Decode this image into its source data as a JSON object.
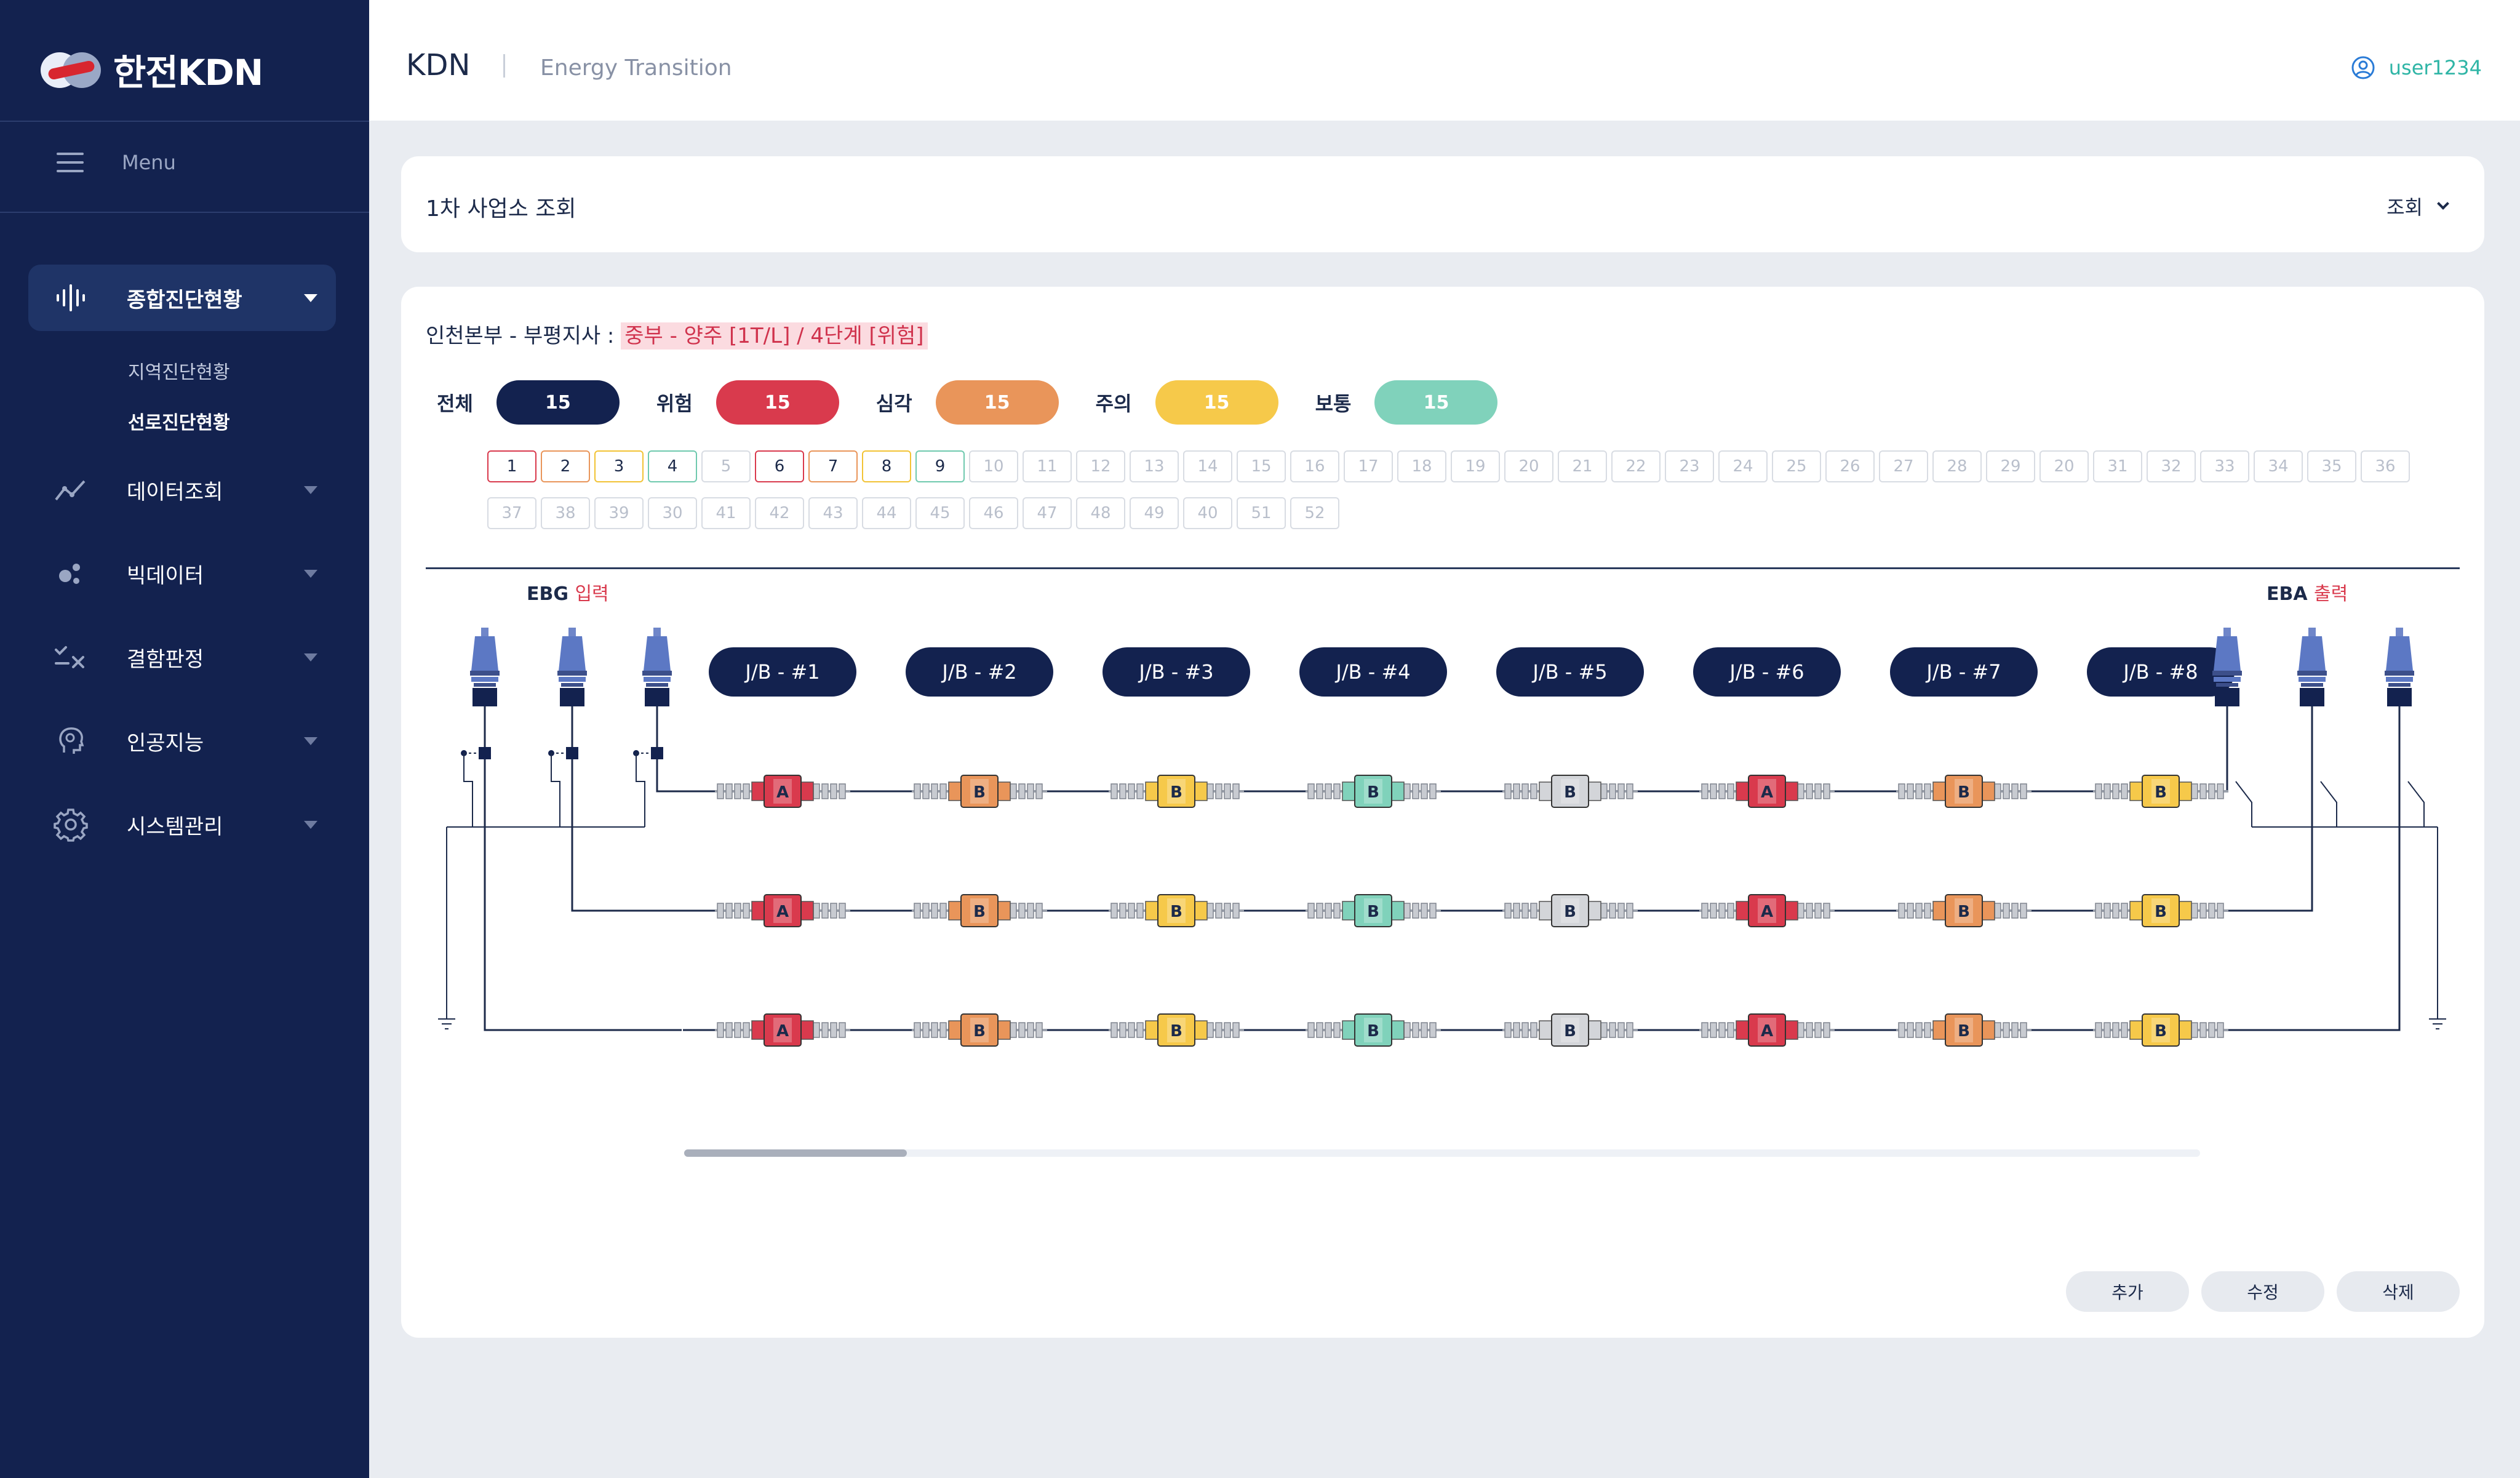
{
  "brand": {
    "logo_text": "한전KDN"
  },
  "sidebar": {
    "menu_label": "Menu",
    "items": [
      {
        "label": "종합진단현황",
        "icon": "waveform-icon",
        "active": true
      },
      {
        "label": "데이터조회",
        "icon": "chart-line-icon"
      },
      {
        "label": "빅데이터",
        "icon": "bubbles-icon"
      },
      {
        "label": "결함판정",
        "icon": "checklist-icon"
      },
      {
        "label": "인공지능",
        "icon": "ai-head-icon"
      },
      {
        "label": "시스템관리",
        "icon": "gear-icon"
      }
    ],
    "sub_items": [
      {
        "label": "지역진단현황",
        "active": false
      },
      {
        "label": "선로진단현황",
        "active": true
      }
    ]
  },
  "header": {
    "title": "KDN",
    "subtitle": "Energy Transition",
    "user": "user1234"
  },
  "search_card": {
    "title": "1차 사업소 조회",
    "button": "조회"
  },
  "location": {
    "prefix": "인천본부 - 부평지사 : ",
    "highlight": "중부 - 양주 [1T/L] / 4단계 [위험]"
  },
  "stats": [
    {
      "label": "전체",
      "value": "15",
      "color": "#13224f"
    },
    {
      "label": "위험",
      "value": "15",
      "color": "#d93a4d"
    },
    {
      "label": "심각",
      "value": "15",
      "color": "#e9955a"
    },
    {
      "label": "주의",
      "value": "15",
      "color": "#f6c94a"
    },
    {
      "label": "보통",
      "value": "15",
      "color": "#80d2bb"
    }
  ],
  "number_rows": [
    [
      "1",
      "2",
      "3",
      "4",
      "5",
      "6",
      "7",
      "8",
      "9",
      "10",
      "11",
      "12",
      "13",
      "14",
      "15",
      "16",
      "17",
      "18",
      "19",
      "20",
      "21",
      "22",
      "23",
      "24",
      "25",
      "26",
      "27",
      "28",
      "29",
      "20",
      "31",
      "32",
      "33",
      "34",
      "35",
      "36"
    ],
    [
      "37",
      "38",
      "39",
      "30",
      "41",
      "42",
      "43",
      "44",
      "45",
      "46",
      "47",
      "48",
      "49",
      "40",
      "51",
      "52"
    ]
  ],
  "number_colors": {
    "1": "#d93a4d",
    "2": "#e9955a",
    "3": "#f2c335",
    "4": "#6fc9ae",
    "6": "#d93a4d",
    "7": "#e9955a",
    "8": "#f2c335",
    "9": "#6fc9ae"
  },
  "diagram": {
    "input_label": "EBG",
    "input_suffix": "입력",
    "output_label": "EBA",
    "output_suffix": "출력",
    "junction_boxes": [
      "J/B - #1",
      "J/B - #2",
      "J/B - #3",
      "J/B - #4",
      "J/B - #5",
      "J/B - #6",
      "J/B - #7",
      "J/B - #8"
    ],
    "lines": [
      [
        "A",
        "B",
        "B",
        "B",
        "B",
        "A",
        "B",
        "B"
      ],
      [
        "A",
        "B",
        "B",
        "B",
        "B",
        "A",
        "B",
        "B"
      ],
      [
        "A",
        "B",
        "B",
        "B",
        "B",
        "A",
        "B",
        "B"
      ]
    ],
    "connector_colors": [
      "#d93a4d",
      "#e9955a",
      "#f6c94a",
      "#80d2bb",
      "#d3d5d9",
      "#d93a4d",
      "#e9955a",
      "#f6c94a"
    ]
  },
  "actions": {
    "add": "추가",
    "edit": "수정",
    "delete": "삭제"
  }
}
